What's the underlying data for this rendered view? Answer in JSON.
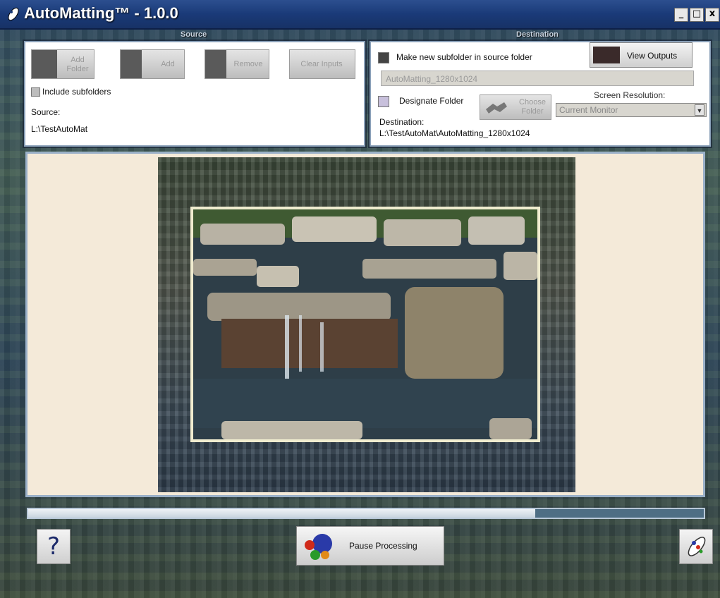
{
  "window": {
    "title": "AutoMatting™ - 1.0.0",
    "minimize_label": "_",
    "maximize_label": "□",
    "close_label": "x"
  },
  "source": {
    "section_label": "Source",
    "add_folder_label": "Add Folder",
    "add_label": "Add",
    "remove_label": "Remove",
    "clear_inputs_label": "Clear Inputs",
    "include_subfolders_label": "Include subfolders",
    "source_caption": "Source:",
    "source_path": "L:\\TestAutoMat"
  },
  "destination": {
    "section_label": "Destination",
    "make_subfolder_label": "Make new subfolder in source folder",
    "view_outputs_label": "View Outputs",
    "subfolder_name": "AutoMatting_1280x1024",
    "designate_folder_label": "Designate Folder",
    "choose_folder_label": "Choose Folder",
    "screen_resolution_label": "Screen Resolution:",
    "screen_resolution_value": "Current Monitor",
    "destination_caption": "Destination:",
    "destination_path": "L:\\TestAutoMat\\AutoMatting_1280x1024"
  },
  "progress": {
    "value_percent": 75
  },
  "footer": {
    "help_label": "?",
    "pause_label": "Pause Processing"
  },
  "colors": {
    "titlebar": "#1a3a78",
    "mat_background": "#f4ead9",
    "accent": "#8aa0b8"
  },
  "icons": {
    "app": "automatting-logo-icon",
    "help": "question-mark-icon",
    "tools": "tools-icon",
    "pause": "processing-icon"
  }
}
